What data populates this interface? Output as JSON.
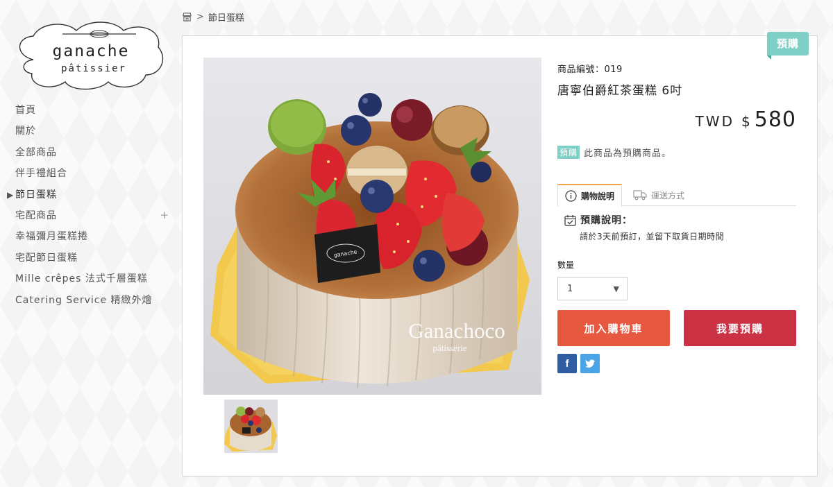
{
  "brand": {
    "line1": "ganache",
    "line2": "pâtissier"
  },
  "nav": {
    "items": [
      {
        "label": "首頁"
      },
      {
        "label": "關於"
      },
      {
        "label": "全部商品"
      },
      {
        "label": "伴手禮組合"
      },
      {
        "label": "節日蛋糕",
        "active": true
      },
      {
        "label": "宅配商品",
        "expandable": true
      },
      {
        "label": "幸福彌月蛋糕捲"
      },
      {
        "label": "宅配節日蛋糕"
      },
      {
        "label": "Mille crêpes 法式千層蛋糕"
      },
      {
        "label": "Catering Service 精緻外燴"
      }
    ],
    "expand_glyph": "+",
    "active_marker": "▶"
  },
  "breadcrumb": {
    "icon": "shop-icon",
    "separator": ">",
    "current": "節日蛋糕"
  },
  "product": {
    "tag": "預購",
    "code": "商品編號：019",
    "title": "唐寧伯爵紅茶蛋糕 6吋",
    "price": {
      "currency": "TWD",
      "symbol": "$",
      "amount": "580"
    },
    "preorder_badge": "預購",
    "preorder_note": "此商品為預購商品。",
    "image_watermark": {
      "line1": "Ganachoco",
      "line2": "pâtisserie"
    },
    "tabs": [
      {
        "label": "購物說明",
        "icon": "info-icon",
        "active": true
      },
      {
        "label": "運送方式",
        "icon": "truck-icon",
        "active": false
      }
    ],
    "preorder_heading": "預購說明：",
    "preorder_detail": "請於3天前預訂，並留下取貨日期時間",
    "quantity_label": "數量",
    "quantity_value": "1",
    "add_to_cart": "加入購物車",
    "preorder_button": "我要預購",
    "share": {
      "facebook": "f"
    }
  },
  "colors": {
    "tag": "#7ed0c6",
    "tab_accent": "#f0a540",
    "cart_button": "#e6583f",
    "preorder_button": "#cb3345",
    "facebook": "#2f5da2",
    "twitter": "#4ba3e8"
  }
}
